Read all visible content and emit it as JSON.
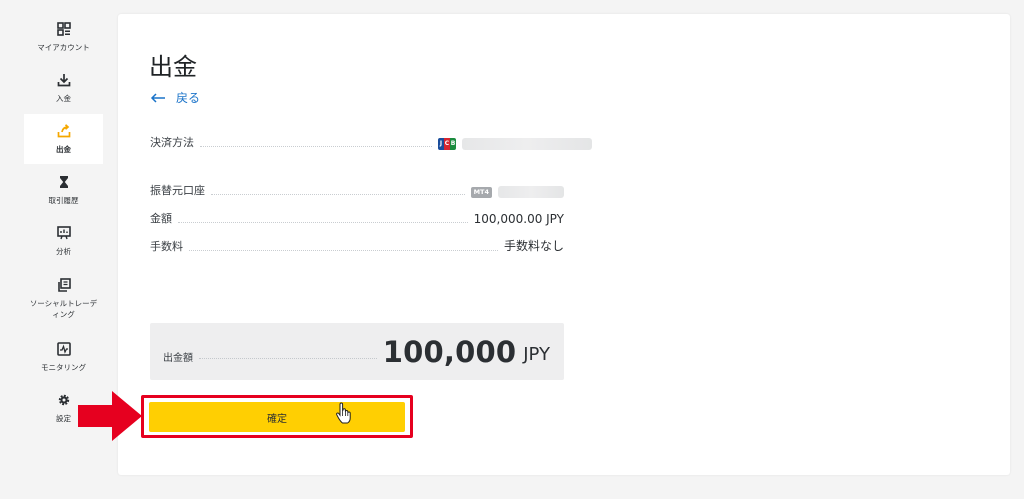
{
  "sidebar": {
    "items": [
      {
        "label": "マイアカウント",
        "icon": "grid-account-icon"
      },
      {
        "label": "入金",
        "icon": "download-icon"
      },
      {
        "label": "出金",
        "icon": "upload-icon",
        "active": true
      },
      {
        "label": "取引履歴",
        "icon": "hourglass-icon"
      },
      {
        "label": "分析",
        "icon": "chart-board-icon"
      },
      {
        "label": "ソーシャルトレーディング",
        "icon": "copy-icon"
      },
      {
        "label": "モニタリング",
        "icon": "monitor-icon"
      },
      {
        "label": "設定",
        "icon": "gear-icon"
      }
    ]
  },
  "main": {
    "title": "出金",
    "back_label": "戻る",
    "rows": {
      "payment_method": {
        "label": "決済方法",
        "value_icon": "jcb-card-icon"
      },
      "transfer_account": {
        "label": "振替元口座",
        "badge": "MT4"
      },
      "amount": {
        "label": "金額",
        "value": "100,000.00 JPY"
      },
      "fee": {
        "label": "手数料",
        "value": "手数料なし"
      }
    },
    "total": {
      "label": "出金額",
      "amount": "100,000",
      "currency": "JPY"
    },
    "confirm_label": "確定"
  },
  "colors": {
    "accent": "#ffcf02",
    "link": "#1a73c9",
    "highlight": "#e6001f",
    "background": "#f4f4f4"
  }
}
